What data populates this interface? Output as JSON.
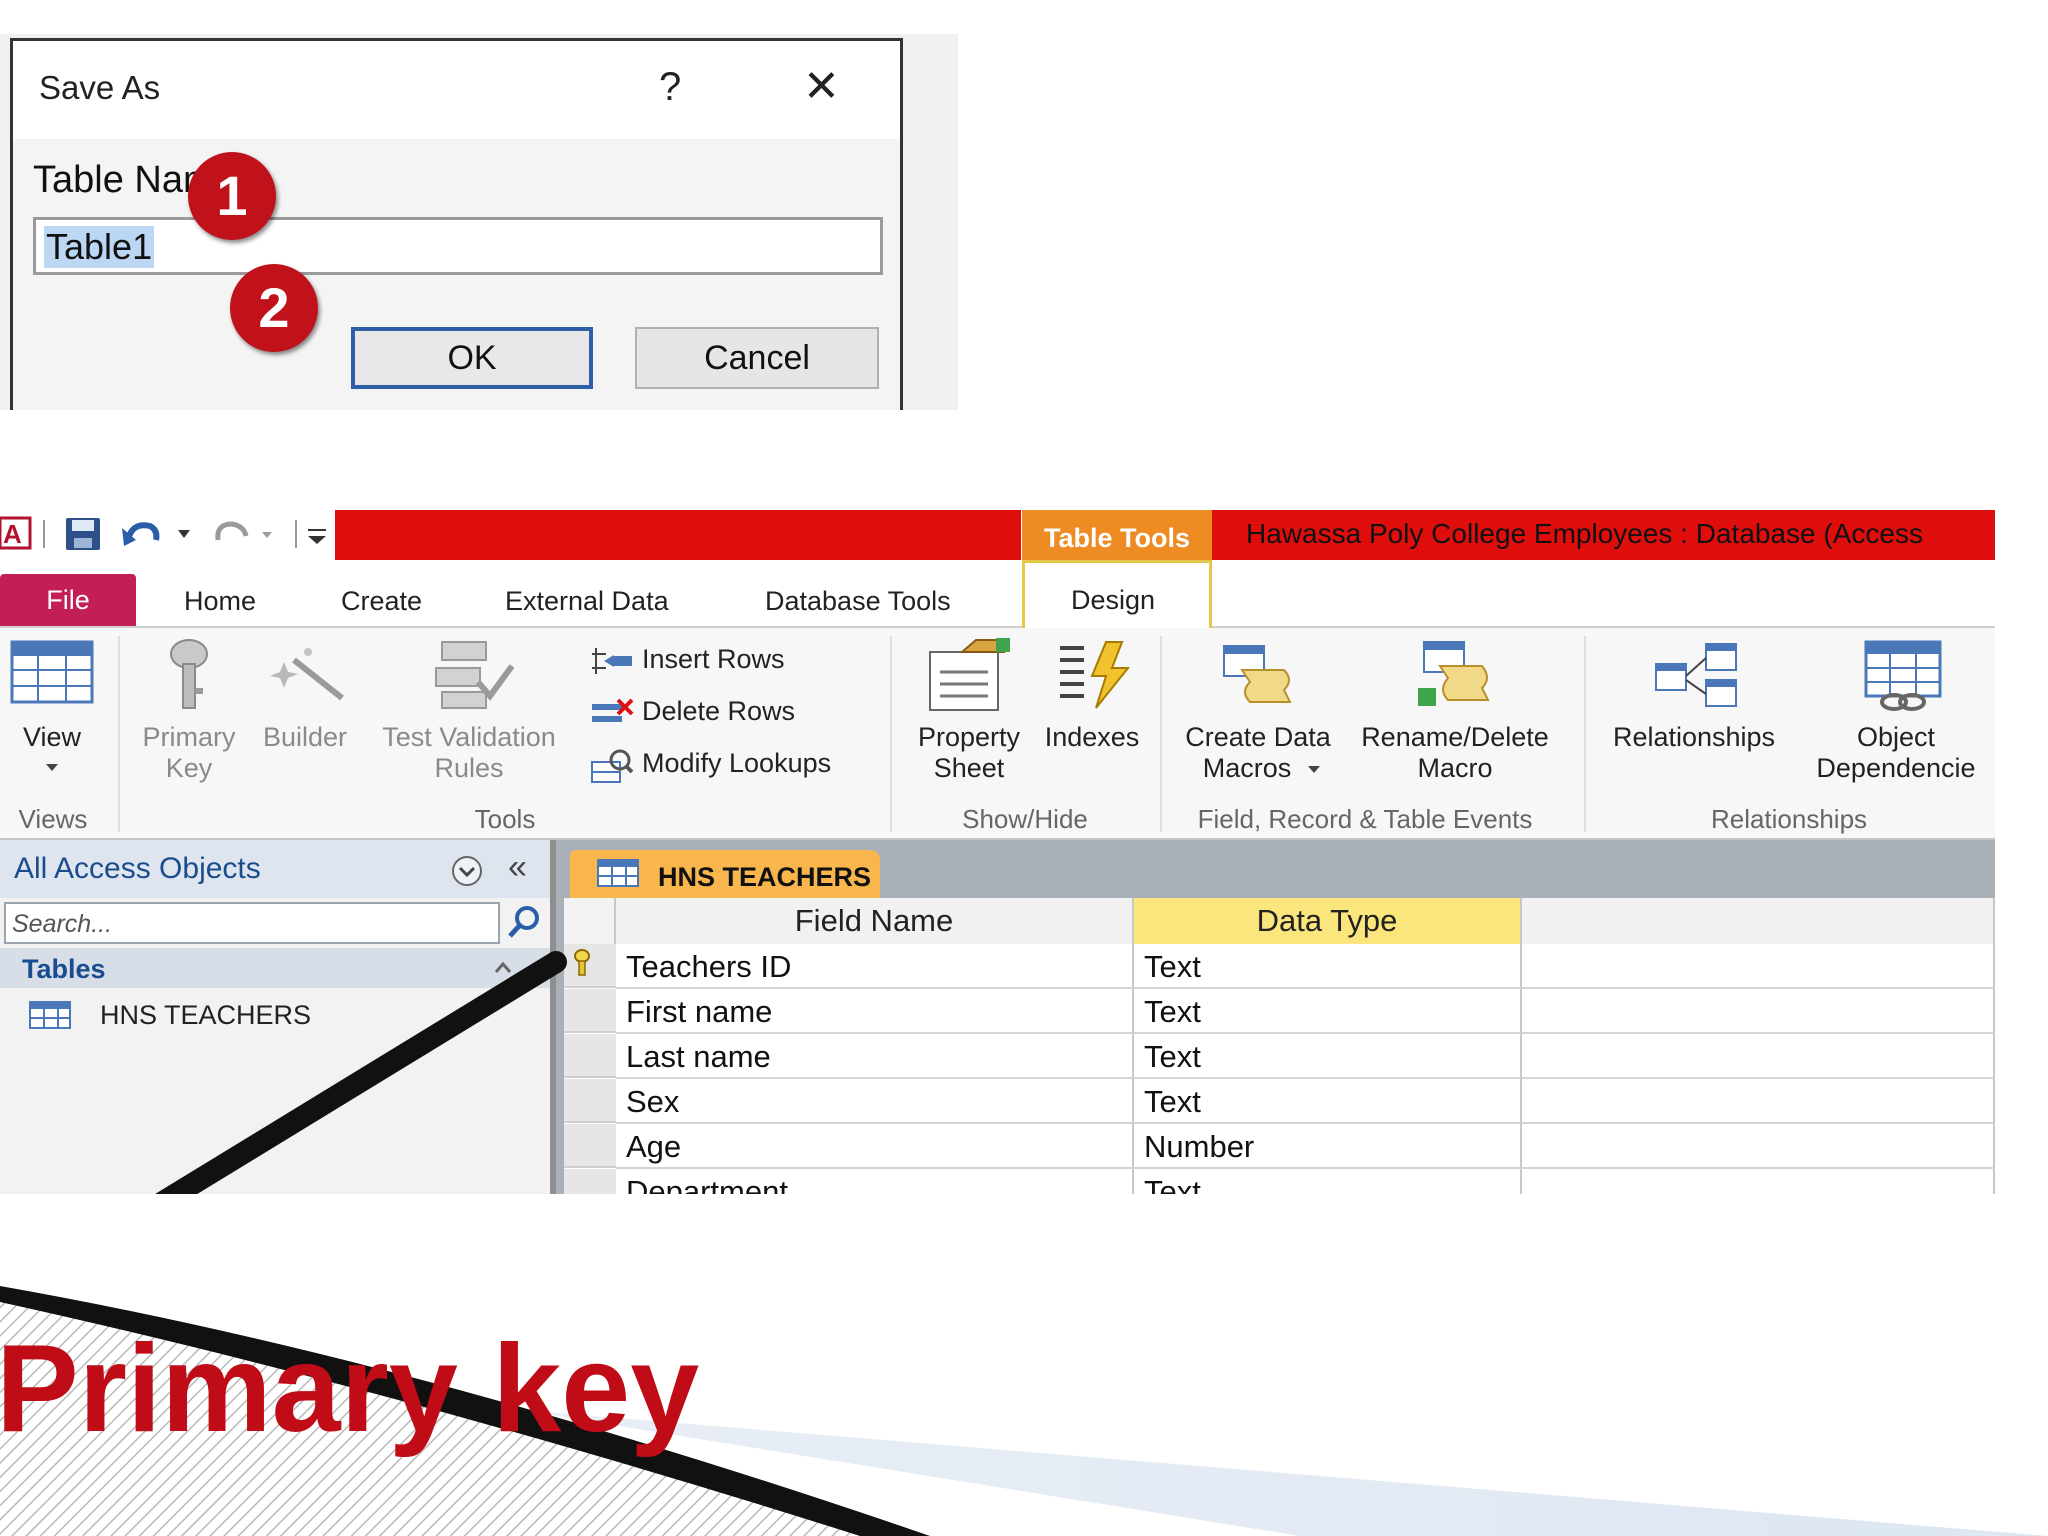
{
  "save_as_dialog": {
    "title": "Save As",
    "help_glyph": "?",
    "close_glyph": "✕",
    "table_name_label": "Table Name:",
    "table_name_value": "Table1",
    "ok_label": "OK",
    "cancel_label": "Cancel",
    "step_badges": [
      "1",
      "2"
    ]
  },
  "access_window": {
    "contextual_tab": "Table Tools",
    "title": "Hawassa Poly College Employees : Database (Access",
    "tabs": [
      "File",
      "Home",
      "Create",
      "External Data",
      "Database Tools",
      "Design"
    ],
    "ribbon": {
      "views": {
        "view_label": "View",
        "group_label": "Views"
      },
      "tools": {
        "primary_key_line1": "Primary",
        "primary_key_line2": "Key",
        "builder_label": "Builder",
        "test_validation_line1": "Test Validation",
        "test_validation_line2": "Rules",
        "insert_rows": "Insert Rows",
        "delete_rows": "Delete Rows",
        "modify_lookups": "Modify Lookups",
        "group_label": "Tools"
      },
      "show_hide": {
        "property_line1": "Property",
        "property_line2": "Sheet",
        "indexes_label": "Indexes",
        "group_label": "Show/Hide"
      },
      "events": {
        "create_line1": "Create Data",
        "create_line2": "Macros",
        "rename_line1": "Rename/Delete",
        "rename_line2": "Macro",
        "group_label": "Field, Record & Table Events"
      },
      "relationships": {
        "relationships_label": "Relationships",
        "object_line1": "Object",
        "object_line2": "Dependencie",
        "group_label": "Relationships"
      }
    },
    "nav_pane": {
      "title": "All Access Objects",
      "collapse_glyph": "«",
      "search_placeholder": "Search...",
      "section": "Tables",
      "items": [
        "HNS TEACHERS"
      ]
    },
    "document_tab": "HNS TEACHERS",
    "grid": {
      "headers": [
        "Field Name",
        "Data Type"
      ],
      "rows": [
        {
          "field": "Teachers ID",
          "type": "Text"
        },
        {
          "field": "First name",
          "type": "Text"
        },
        {
          "field": "Last name",
          "type": "Text"
        },
        {
          "field": "Sex",
          "type": "Text"
        },
        {
          "field": "Age",
          "type": "Number"
        },
        {
          "field": "Department",
          "type": "Text"
        }
      ]
    }
  },
  "slide_heading": "Primary key",
  "colors": {
    "accent_red": "#c00c16",
    "title_bar_red": "#e00d0d",
    "table_tools_orange": "#ee8b22",
    "file_tab": "#c41e56"
  }
}
